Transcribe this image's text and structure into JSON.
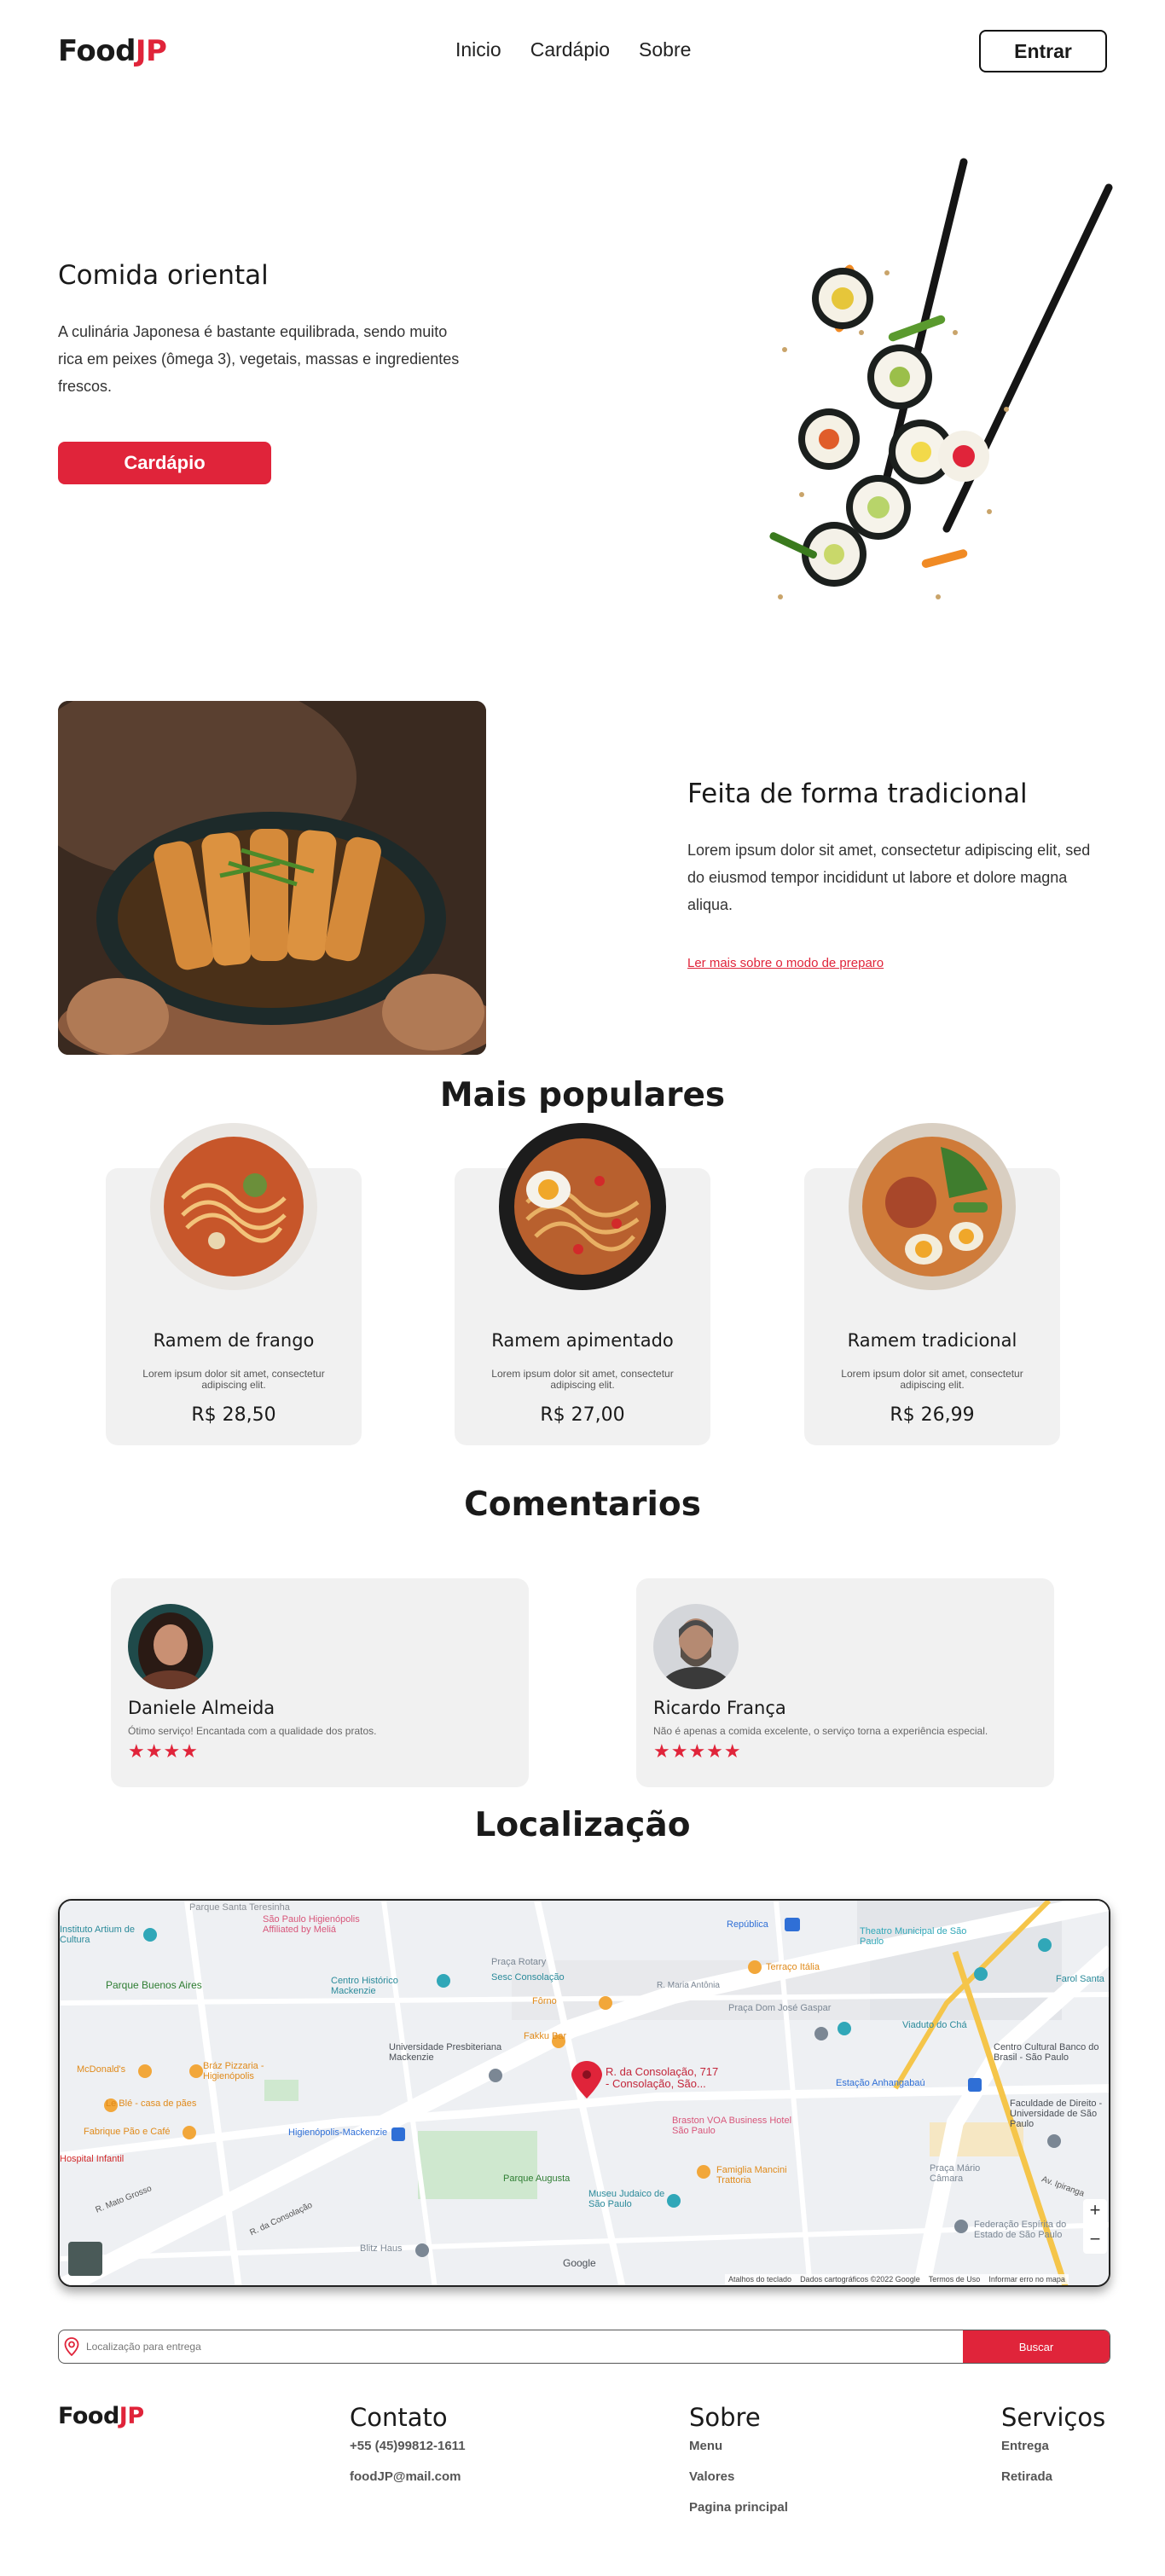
{
  "brand": {
    "name_part1": "Food",
    "name_part2": "JP",
    "accent": "#e0243a"
  },
  "nav": {
    "links": [
      "Inicio",
      "Cardápio",
      "Sobre"
    ],
    "login_label": "Entrar"
  },
  "hero": {
    "title": "Comida oriental",
    "text": "A culinária Japonesa é bastante equilibrada, sendo muito rica em peixes (ômega 3), vegetais, massas e ingredientes frescos.",
    "button": "Cardápio"
  },
  "tradition": {
    "title": "Feita de forma tradicional",
    "text": "Lorem ipsum dolor sit amet, consectetur adipiscing elit, sed do eiusmod tempor incididunt ut labore et dolore magna aliqua.",
    "link": "Ler mais sobre o modo de preparo"
  },
  "popular": {
    "heading": "Mais populares",
    "items": [
      {
        "name": "Ramem de frango",
        "desc": "Lorem ipsum dolor sit amet, consectetur adipiscing elit.",
        "price": "R$ 28,50"
      },
      {
        "name": "Ramem apimentado",
        "desc": "Lorem ipsum dolor sit amet, consectetur adipiscing elit.",
        "price": "R$ 27,00"
      },
      {
        "name": "Ramem tradicional",
        "desc": "Lorem ipsum dolor sit amet, consectetur adipiscing elit.",
        "price": "R$ 26,99"
      }
    ]
  },
  "comments": {
    "heading": "Comentarios",
    "items": [
      {
        "name": "Daniele Almeida",
        "text": "Ótimo serviço! Encantada com a qualidade dos pratos.",
        "stars": "★★★★"
      },
      {
        "name": "Ricardo França",
        "text": "Não é apenas a comida excelente, o serviço torna a experiência especial.",
        "stars": "★★★★★"
      }
    ]
  },
  "location": {
    "heading": "Localização",
    "map": {
      "pin_label_1": "R. da Consolação, 717",
      "pin_label_2": "- Consolação, São...",
      "places": [
        "Parque Santa Teresinha",
        "Instituto Artium de Cultura",
        "São Paulo Higienópolis Affiliated by Meliá",
        "Parque Buenos Aires",
        "Centro Histórico Mackenzie",
        "Praça Rotary",
        "Sesc Consolação",
        "Universidade Presbiteriana Mackenzie",
        "Fôrno",
        "Fakku Bar",
        "República",
        "Theatro Municipal de São Paulo",
        "Terraço Itália",
        "Praça Dom José Gaspar",
        "Viaduto do Chá",
        "Centro Cultural Banco do Brasil - São Paulo",
        "Estação Anhangabaú",
        "Faculdade de Direito - Universidade de São Paulo",
        "Praça Mário Câmara",
        "Federação Espírita do Estado de São Paulo",
        "McDonald's",
        "Bráz Pizzaria - Higienópolis",
        "Le Blé - casa de pães",
        "Fabrique Pão e Café",
        "Hospital Infantil",
        "Higienópolis-Mackenzie",
        "Parque Augusta",
        "Braston VOA Business Hotel São Paulo",
        "Famiglia Mancini Trattoria",
        "Museu Judaico de São Paulo",
        "Blitz Haus",
        "Farol Santa",
        "R. Maria Antônia",
        "R. da Consolação",
        "R. Mato Grosso",
        "Av. Ipiranga"
      ],
      "footer": [
        "Atalhos do teclado",
        "Dados cartográficos ©2022 Google",
        "Termos de Uso",
        "Informar erro no mapa"
      ],
      "zoom_in": "+",
      "zoom_out": "−",
      "google": "Google"
    },
    "search_placeholder": "Localização para entrega",
    "search_button": "Buscar"
  },
  "footer": {
    "contact_title": "Contato",
    "phone": "+55 (45)99812-1611",
    "email": "foodJP@mail.com",
    "about_title": "Sobre",
    "about_links": [
      "Menu",
      "Valores",
      "Pagina principal"
    ],
    "services_title": "Serviços",
    "services_links": [
      "Entrega",
      "Retirada"
    ]
  }
}
